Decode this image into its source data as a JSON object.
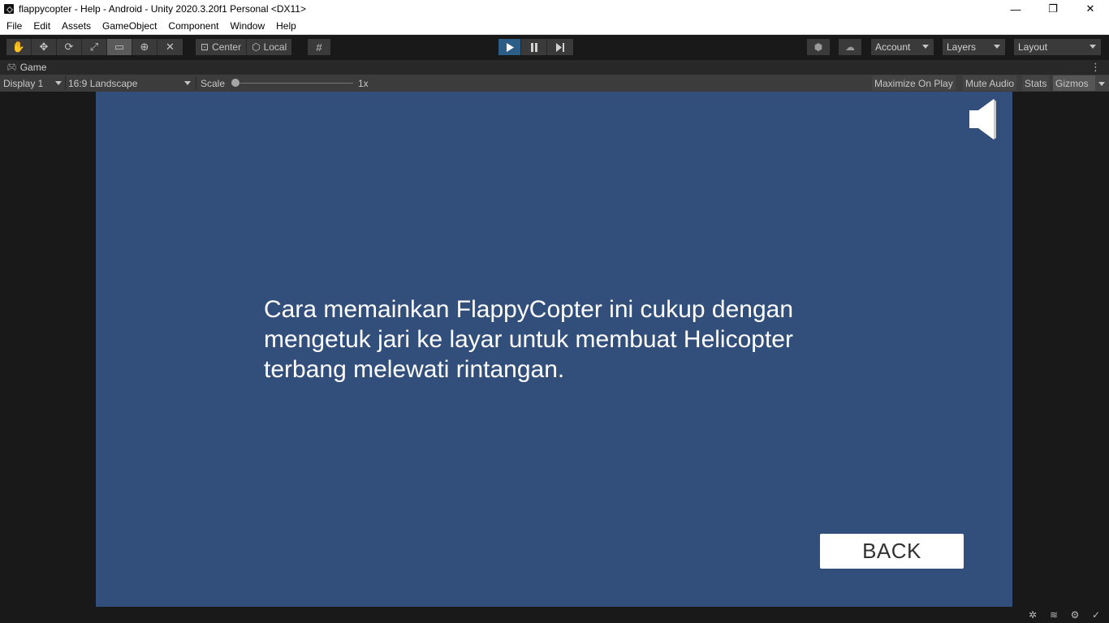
{
  "window": {
    "title": "flappycopter - Help - Android - Unity 2020.3.20f1 Personal <DX11>",
    "controls": {
      "minimize": "—",
      "restore": "❐",
      "close": "✕"
    }
  },
  "menu": [
    "File",
    "Edit",
    "Assets",
    "GameObject",
    "Component",
    "Window",
    "Help"
  ],
  "toolbar": {
    "tools": [
      {
        "name": "hand-tool",
        "glyph": "✋"
      },
      {
        "name": "move-tool",
        "glyph": "✥"
      },
      {
        "name": "rotate-tool",
        "glyph": "⟳"
      },
      {
        "name": "scale-tool",
        "glyph": "⤢"
      },
      {
        "name": "rect-tool",
        "glyph": "▭"
      },
      {
        "name": "transform-tool",
        "glyph": "⊕"
      },
      {
        "name": "custom-tool",
        "glyph": "✕"
      }
    ],
    "pivot_label": "Center",
    "space_label": "Local",
    "grid_glyph": "#",
    "account_label": "Account",
    "layers_label": "Layers",
    "layout_label": "Layout",
    "accent": "#2c5d87"
  },
  "game_tab": {
    "label": "Game",
    "display_label": "Display 1",
    "aspect_label": "16:9 Landscape",
    "scale_label": "Scale",
    "scale_value": "1x",
    "maximize_label": "Maximize On Play",
    "mute_label": "Mute Audio",
    "stats_label": "Stats",
    "gizmos_label": "Gizmos"
  },
  "game": {
    "background": "#324f7b",
    "help_text": "Cara memainkan FlappyCopter ini  cukup dengan\nmengetuk jari ke layar untuk membuat Helicopter\nterbang melewati rintangan.",
    "back_label": "BACK",
    "sound_icon": "speaker-icon"
  }
}
